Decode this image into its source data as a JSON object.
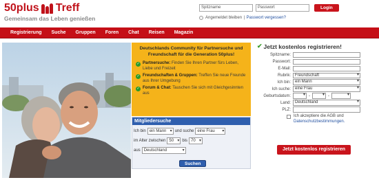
{
  "header": {
    "logo_left": "50plus",
    "logo_right": "Treff",
    "tagline": "Gemeinsam das Leben genießen"
  },
  "login": {
    "username_placeholder": "Spitzname",
    "password_placeholder": "Passwort",
    "button": "Login",
    "remember": "Angemeldet bleiben",
    "separator": "|",
    "forgot": "Passwort vergessen?"
  },
  "nav": {
    "items": [
      "Registrierung",
      "Suche",
      "Gruppen",
      "Foren",
      "Chat",
      "Reisen",
      "Magazin"
    ]
  },
  "promo": {
    "headline": "Deutschlands Community für Partnersuche und Freundschaft für die Generation 50plus!",
    "features": [
      {
        "title": "Partnersuche:",
        "text": "Finden Sie Ihren Partner fürs Leben, Liebe und Freizeit"
      },
      {
        "title": "Freundschaften & Gruppen:",
        "text": "Treffen Sie neue Freunde aus Ihrer Umgebung"
      },
      {
        "title": "Forum & Chat:",
        "text": "Tauschen Sie sich mit Gleichgesinnten aus"
      }
    ]
  },
  "search": {
    "title": "Mitgliedersuche",
    "ich_bin": "Ich bin",
    "gender": "ein Mann",
    "und_suche": "und suche",
    "target": "eine Frau",
    "im_alter": "im Alter zwischen",
    "age_from": "50",
    "bis": "bis",
    "age_to": "70",
    "aus": "aus",
    "country": "Deutschland",
    "button": "Suchen"
  },
  "register": {
    "title": "Jetzt kostenlos registrieren!",
    "fields": [
      {
        "label": "Spitzname:",
        "value": "",
        "select": false
      },
      {
        "label": "Passwort:",
        "value": "",
        "select": false
      },
      {
        "label": "E-Mail:",
        "value": "",
        "select": false
      },
      {
        "label": "Rubrik:",
        "value": "Freundschaft",
        "select": true
      },
      {
        "label": "Ich bin:",
        "value": "ein Mann",
        "select": true
      },
      {
        "label": "Ich suche:",
        "value": "eine Frau",
        "select": true
      }
    ],
    "birthdate_label": "Geburtsdatum:",
    "birthdate_day": "",
    "birthdate_month": "",
    "birthdate_year": "",
    "land_label": "Land:",
    "land_value": "Deutschland",
    "plz_label": "PLZ:",
    "agb_text": "Ich akzeptiere die AGB und",
    "agb_link": "Datenschutzbestimmungen.",
    "button": "Jetzt kostenlos registrieren"
  },
  "colors": {
    "brand_red": "#c50f17",
    "promo_yellow": "#f5b31a",
    "search_blue": "#2f5fae",
    "check_green": "#2a9a2a"
  }
}
